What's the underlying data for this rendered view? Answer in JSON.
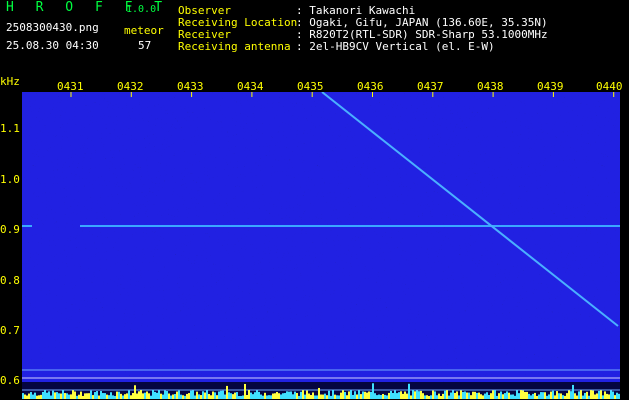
{
  "header": {
    "logo": "H R O F F T",
    "version": "1.0.0",
    "filename": "2508300430.png",
    "datetime": "25.08.30 04:30",
    "meteor_label": "meteor",
    "meteor_count": "57"
  },
  "info": {
    "observer_label": "Observer",
    "observer_value": ": Takanori Kawachi",
    "location_label": "Receiving Location",
    "location_value": ": Ogaki, Gifu, JAPAN (136.60E, 35.35N)",
    "receiver_label": "Receiver",
    "receiver_value": ": R820T2(RTL-SDR) SDR-Sharp 53.1000MHz",
    "antenna_label": "Receiving antenna",
    "antenna_value": ": 2el-HB9CV Vertical (el. E-W)"
  },
  "axis": {
    "y_unit": "kHz",
    "x_ticks": [
      "0431",
      "0432",
      "0433",
      "0434",
      "0435",
      "0436",
      "0437",
      "0438",
      "0439",
      "0440"
    ],
    "y_ticks": [
      "1.1",
      "1.0",
      "0.9",
      "0.8",
      "0.7",
      "0.6"
    ]
  },
  "colors": {
    "background": "#000000",
    "text_header": "#00ff40",
    "text_info": "#ffffff",
    "axis_label": "#ffff00",
    "noise": "#0a0a6a",
    "signal": "#40a0ff"
  }
}
